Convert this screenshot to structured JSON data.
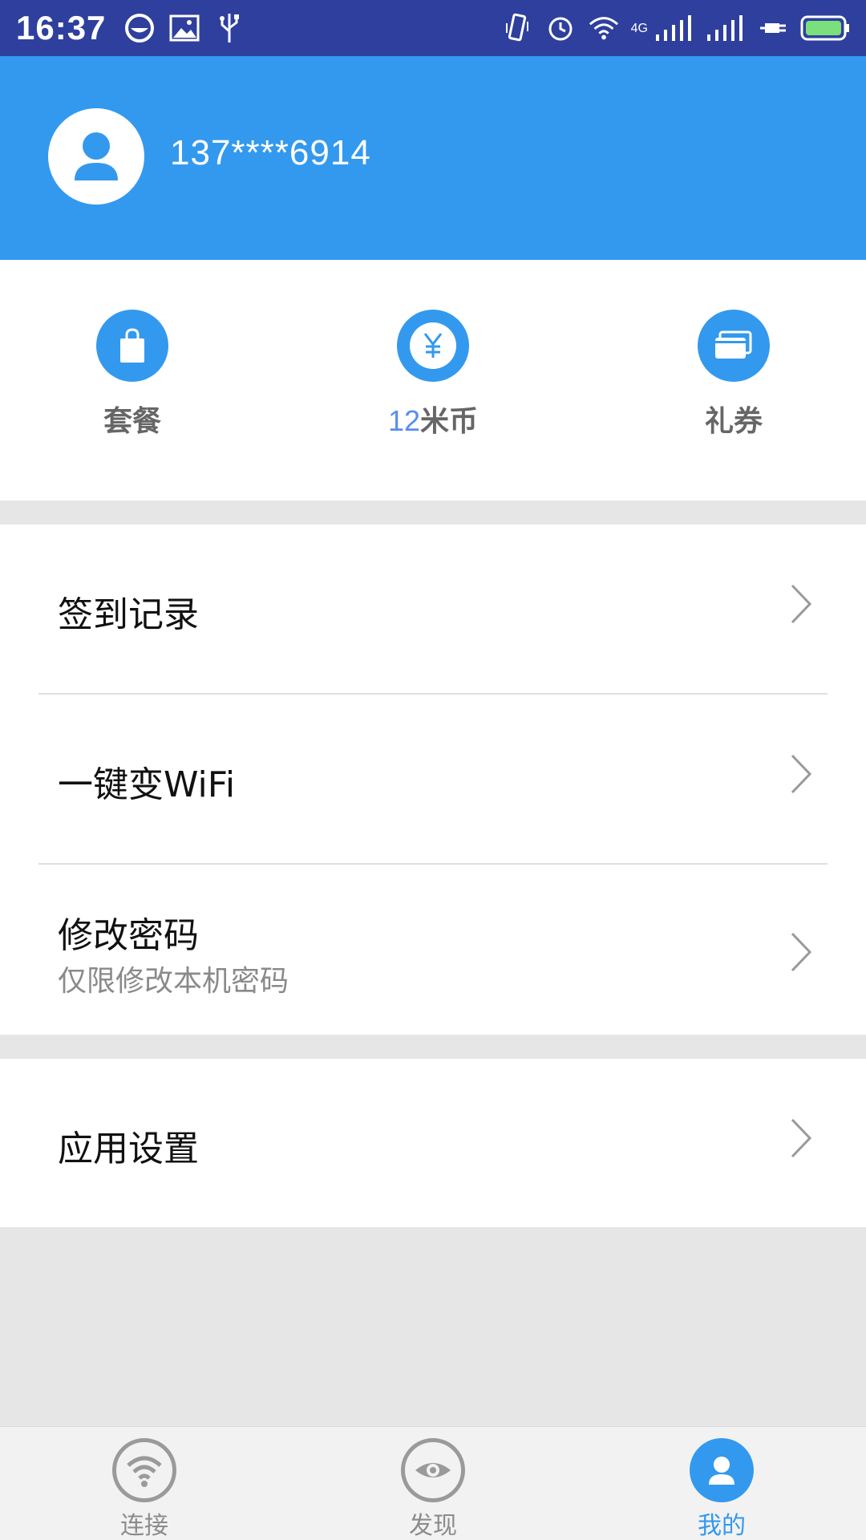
{
  "status_bar": {
    "time": "16:37",
    "network_type": "4G",
    "left_icons": [
      "app-notification-icon",
      "image-icon",
      "usb-icon"
    ],
    "right_icons": [
      "vibrate-icon",
      "alarm-icon",
      "wifi-icon",
      "signal-icon",
      "signal-icon",
      "charging-icon",
      "battery-icon"
    ]
  },
  "profile": {
    "phone": "137****6914",
    "avatar_icon": "user-icon"
  },
  "quick_actions": [
    {
      "label": "套餐",
      "icon": "shopping-bag-icon"
    },
    {
      "value": "12",
      "label": "米币",
      "icon": "yuan-coin-icon"
    },
    {
      "label": "礼券",
      "icon": "cards-icon"
    }
  ],
  "menu": {
    "sign_in_records": "签到记录",
    "one_key_wifi": "一键变WiFi",
    "change_password": "修改密码",
    "change_password_sub": "仅限修改本机密码",
    "app_settings": "应用设置"
  },
  "bottom_nav": [
    {
      "label": "连接",
      "icon": "wifi-icon",
      "active": false
    },
    {
      "label": "发现",
      "icon": "eye-icon",
      "active": false
    },
    {
      "label": "我的",
      "icon": "user-icon",
      "active": true
    }
  ],
  "colors": {
    "status_bar": "#2f3f9e",
    "header": "#3399ee",
    "accent": "#3399ee",
    "mibi_number": "#5b8def",
    "background": "#e6e6e6"
  }
}
